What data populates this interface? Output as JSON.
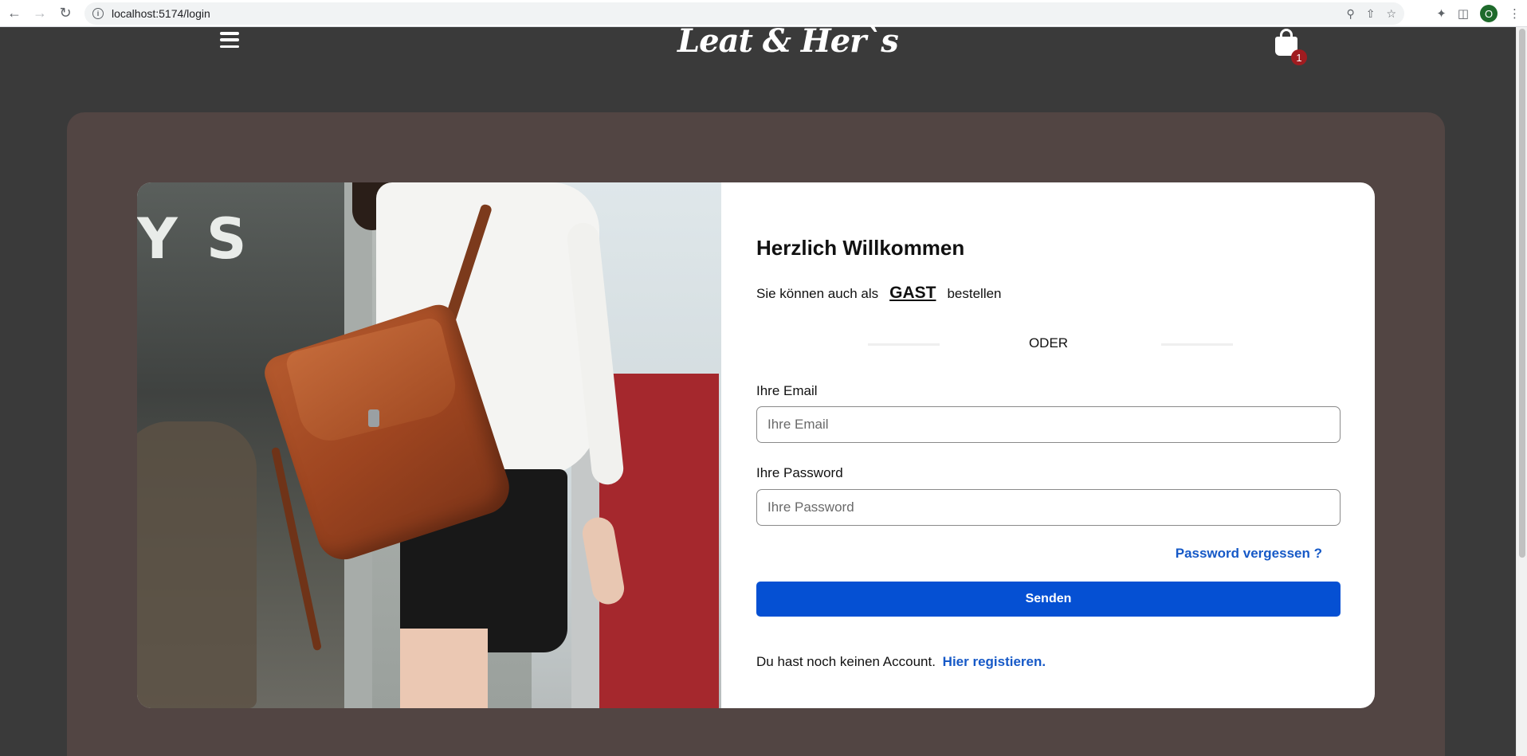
{
  "browser": {
    "url": "localhost:5174/login",
    "profile_initial": "O"
  },
  "header": {
    "logo_text": "Leat & Her`s",
    "cart_count": "1"
  },
  "login": {
    "title": "Herzlich Willkommen",
    "guest_prefix": "Sie können auch als",
    "guest_link": "GAST",
    "guest_suffix": "bestellen",
    "divider_text": "ODER",
    "email_label": "Ihre Email",
    "email_placeholder": "Ihre Email",
    "password_label": "Ihre Password",
    "password_placeholder": "Ihre Password",
    "forgot_link": "Password vergessen ?",
    "submit_label": "Senden",
    "register_prefix": "Du hast noch keinen Account.",
    "register_link": "Hier registieren."
  },
  "colors": {
    "page_bg": "#3a3a3a",
    "panel_bg": "#524543",
    "primary_button": "#0550d3",
    "link": "#1659c7",
    "badge": "#a01c20"
  }
}
